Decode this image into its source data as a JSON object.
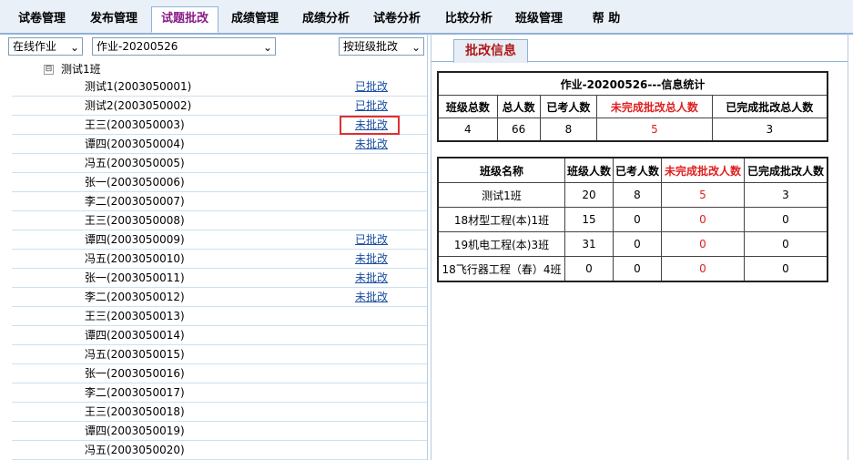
{
  "nav": {
    "tabs": [
      "试卷管理",
      "发布管理",
      "试题批改",
      "成绩管理",
      "成绩分析",
      "试卷分析",
      "比较分析",
      "班级管理",
      "帮  助"
    ],
    "active": "试题批改"
  },
  "left": {
    "type_select": "在线作业",
    "homework_select": "作业-20200526",
    "mode_select": "按班级批改",
    "tree_root": "测试1班",
    "tree_toggle": "⊟",
    "students": [
      {
        "name": "测试1(2003050001)",
        "status": "已批改"
      },
      {
        "name": "测试2(2003050002)",
        "status": "已批改"
      },
      {
        "name": "王三(2003050003)",
        "status": "未批改"
      },
      {
        "name": "谭四(2003050004)",
        "status": "未批改"
      },
      {
        "name": "冯五(2003050005)",
        "status": ""
      },
      {
        "name": "张一(2003050006)",
        "status": ""
      },
      {
        "name": "李二(2003050007)",
        "status": ""
      },
      {
        "name": "王三(2003050008)",
        "status": ""
      },
      {
        "name": "谭四(2003050009)",
        "status": "已批改"
      },
      {
        "name": "冯五(2003050010)",
        "status": "未批改"
      },
      {
        "name": "张一(2003050011)",
        "status": "未批改"
      },
      {
        "name": "李二(2003050012)",
        "status": "未批改"
      },
      {
        "name": "王三(2003050013)",
        "status": ""
      },
      {
        "name": "谭四(2003050014)",
        "status": ""
      },
      {
        "name": "冯五(2003050015)",
        "status": ""
      },
      {
        "name": "张一(2003050016)",
        "status": ""
      },
      {
        "name": "李二(2003050017)",
        "status": ""
      },
      {
        "name": "王三(2003050018)",
        "status": ""
      },
      {
        "name": "谭四(2003050019)",
        "status": ""
      },
      {
        "name": "冯五(2003050020)",
        "status": ""
      }
    ]
  },
  "right": {
    "tab_label": "批改信息",
    "stats_title": "作业-20200526---信息统计",
    "stats_headers": [
      "班级总数",
      "总人数",
      "已考人数",
      "未完成批改总人数",
      "已完成批改总人数"
    ],
    "stats_values": [
      "4",
      "66",
      "8",
      "5",
      "3"
    ],
    "class_headers": [
      "班级名称",
      "班级人数",
      "已考人数",
      "未完成批改人数",
      "已完成批改人数"
    ],
    "classes": [
      [
        "测试1班",
        "20",
        "8",
        "5",
        "3"
      ],
      [
        "18材型工程(本)1班",
        "15",
        "0",
        "0",
        "0"
      ],
      [
        "19机电工程(本)3班",
        "31",
        "0",
        "0",
        "0"
      ],
      [
        "18飞行器工程（春）4班",
        "0",
        "0",
        "0",
        "0"
      ]
    ]
  },
  "colors": {
    "active_tab_text": "#8a1b8a",
    "panel_tab_text": "#b01818",
    "link": "#1a4fa0",
    "highlight_box": "#e03030",
    "alert_value": "#e02020"
  }
}
